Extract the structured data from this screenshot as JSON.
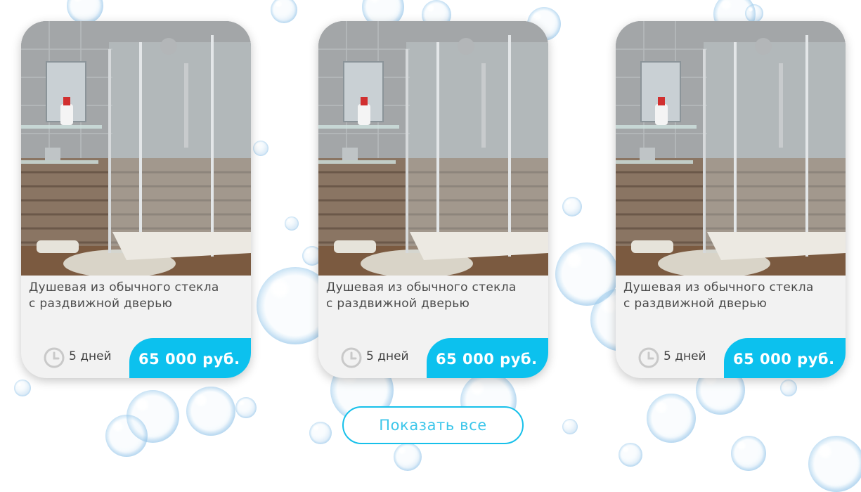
{
  "products": [
    {
      "title_line1": "Душевая из обычного стекла",
      "title_line2": "с раздвижной дверью",
      "duration": "5 дней",
      "price": "65 000 руб.",
      "image": "shower-cabin-photo",
      "clock_icon": "clock-icon"
    },
    {
      "title_line1": "Душевая из обычного стекла",
      "title_line2": "с раздвижной дверью",
      "duration": "5 дней",
      "price": "65 000 руб.",
      "image": "shower-cabin-photo",
      "clock_icon": "clock-icon"
    },
    {
      "title_line1": "Душевая из обычного стекла",
      "title_line2": "с раздвижной дверью",
      "duration": "5 дней",
      "price": "65 000 руб.",
      "image": "shower-cabin-photo",
      "clock_icon": "clock-icon"
    }
  ],
  "show_all_button": "Показать все",
  "colors": {
    "accent": "#0cc1ee",
    "card_bg": "#f2f2f2",
    "text": "#4a4a4a",
    "button_border": "#17c0ea"
  }
}
